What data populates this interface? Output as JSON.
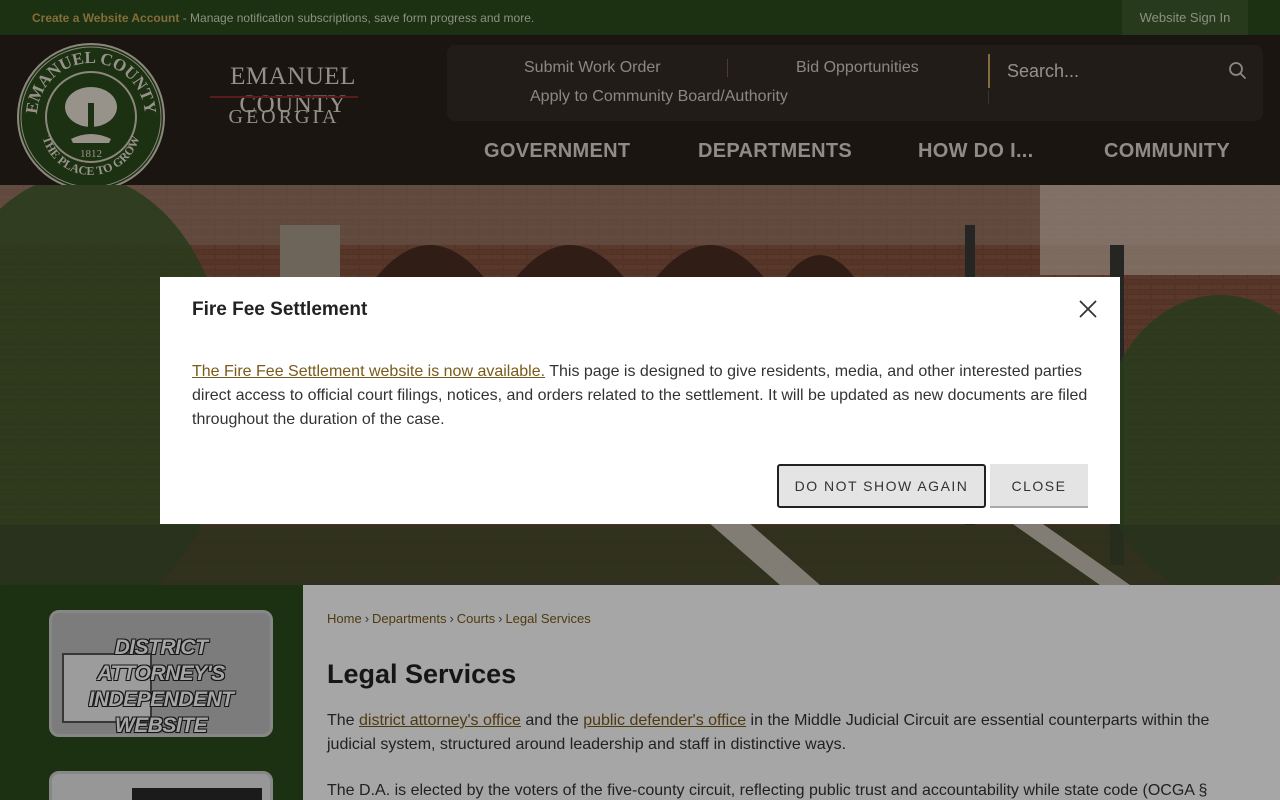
{
  "topbar": {
    "create_account": "Create a Website Account",
    "message": " - Manage notification subscriptions, save form progress and more.",
    "sign_in": "Website Sign In"
  },
  "branding": {
    "name": "EMANUEL COUNTY",
    "state": "GEORGIA",
    "seal_top": "EMANUEL COUNTY",
    "seal_bottom": "THE PLACE TO GROW",
    "seal_year": "1812"
  },
  "quicklinks": {
    "submit_work_order": "Submit Work Order",
    "bid_opportunities": "Bid Opportunities",
    "apply_board": "Apply to Community Board/Authority"
  },
  "search": {
    "placeholder": "Search..."
  },
  "nav": {
    "government": "GOVERNMENT",
    "departments": "DEPARTMENTS",
    "how_do_i": "HOW DO I...",
    "community": "COMMUNITY"
  },
  "sidebar": {
    "promo1": "DISTRICT ATTORNEY'S INDEPENDENT WEBSITE"
  },
  "breadcrumb": [
    "Home",
    "Departments",
    "Courts",
    "Legal Services"
  ],
  "main": {
    "title": "Legal Services",
    "p1_start": "The ",
    "p1_link1": "district attorney's office",
    "p1_mid": " and the ",
    "p1_link2": "public defender's office",
    "p1_end": " in the Middle Judicial Circuit are essential counterparts within the judicial system, structured around leadership and staff in distinctive ways.",
    "p2": "The D.A. is elected by the voters of the five-county circuit, reflecting public trust and accountability while state code (OCGA §"
  },
  "modal": {
    "title": "Fire Fee Settlement",
    "link": "The Fire Fee Settlement website is now available.",
    "body": " This page is designed to give residents, media, and other interested parties direct access to official court filings, notices, and orders related to the settlement. It will be updated as new documents are filed throughout the duration of the case.",
    "do_not_show": "DO NOT SHOW AGAIN",
    "close": "CLOSE"
  }
}
